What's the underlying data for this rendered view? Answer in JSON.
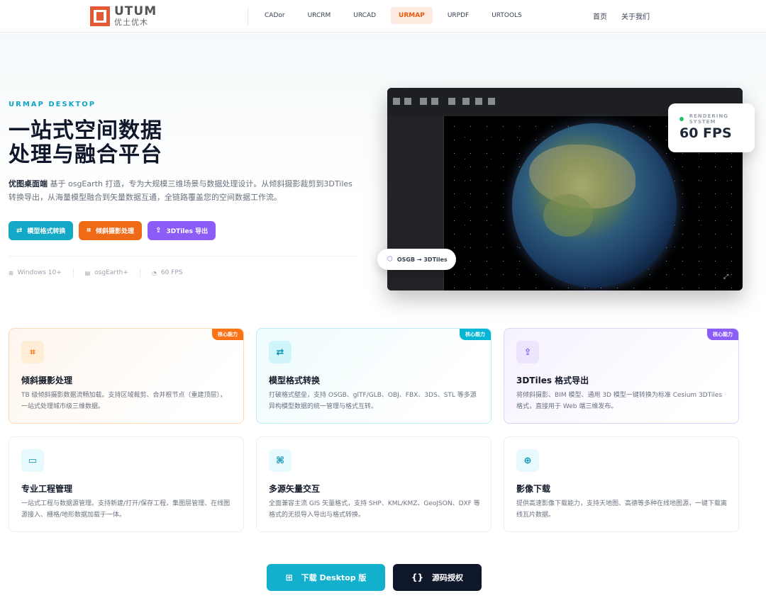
{
  "nav": {
    "logo_en": "UTUM",
    "logo_cn": "优土优木",
    "links": [
      "CADor",
      "URCRM",
      "URCAD",
      "URMAP",
      "URPDF",
      "URTOOLS"
    ],
    "active": "URMAP",
    "right": [
      "首页",
      "关于我们"
    ]
  },
  "hero": {
    "eyebrow": "URMAP DESKTOP",
    "title_line1": "一站式空间数据",
    "title_line2": "处理与融合平台",
    "desc_strong": "优图桌面端",
    "desc": " 基于 osgEarth 打造，专为大规模三维场景与数据处理设计。从倾斜摄影裁剪到3DTiles转换导出，从海量模型融合到矢量数据互通，全链路覆盖您的空间数据工作流。",
    "buttons": [
      {
        "label": "模型格式转换",
        "icon": "swap-icon",
        "color": "#12a8c6"
      },
      {
        "label": "倾斜摄影处理",
        "icon": "crop-icon",
        "color": "#ef6a17"
      },
      {
        "label": "3DTiles 导出",
        "icon": "export-icon",
        "color": "#8b5cf6"
      }
    ],
    "meta": [
      "Windows 10+",
      "osgEarth+",
      "60 FPS"
    ]
  },
  "preview": {
    "rendering_label": "RENDERING SYSTEM",
    "fps": "60 FPS",
    "osgb_label": "OSGB → 3DTiles"
  },
  "badge": "核心能力",
  "cards": [
    {
      "title": "倾斜摄影处理",
      "desc": "TB 级倾斜摄影数据流畅加载。支持区域裁剪、合并根节点（重建顶层），一站式处理城市级三维数据。",
      "icon": "crop-icon",
      "color": "#f97316"
    },
    {
      "title": "模型格式转换",
      "desc": "打破格式壁垒，支持 OSGB、glTF/GLB、OBJ、FBX、3DS、STL 等多源异构模型数据的统一管理与格式互转。",
      "icon": "swap-icon",
      "color": "#06b6d4"
    },
    {
      "title": "3DTiles 格式导出",
      "desc": "将倾斜摄影、BIM 模型、通用 3D 模型一键转换为标准 Cesium 3DTiles 格式，直接用于 Web 端三维发布。",
      "icon": "export-icon",
      "color": "#8b5cf6"
    },
    {
      "title": "专业工程管理",
      "desc": "一站式工程与数据源管理。支持新建/打开/保存工程，集图层管理、在线图源接入、栅格/地形数据加载于一体。",
      "icon": "folder-gear-icon",
      "color": "#06b6d4"
    },
    {
      "title": "多源矢量交互",
      "desc": "全面兼容主流 GIS 矢量格式，支持 SHP、KML/KMZ、GeoJSON、DXF 等格式的无损导入导出与格式转换。",
      "icon": "vector-nodes-icon",
      "color": "#06b6d4"
    },
    {
      "title": "影像下载",
      "desc": "提供高速影像下载能力，支持天地图、高德等多种在线地图源，一键下载离线瓦片数据。",
      "icon": "download-icon",
      "color": "#06b6d4"
    }
  ],
  "downloads": {
    "desktop": "下载 Desktop 版",
    "source": "源码授权"
  }
}
